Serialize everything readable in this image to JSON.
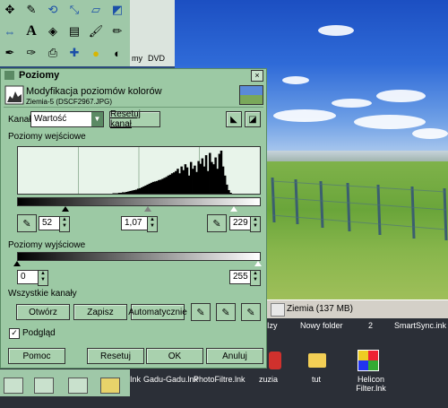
{
  "dialog": {
    "title": "Poziomy",
    "close": "×",
    "header_title": "Modyfikacja poziomów kolorów",
    "header_subtitle": "Ziemia-5 (DSCF2967.JPG)"
  },
  "channel": {
    "label": "Kanał:",
    "value": "Wartość",
    "reset_label": "Resetuj kanał"
  },
  "input_levels": {
    "label": "Poziomy wejściowe",
    "low": "52",
    "gamma": "1,07",
    "high": "229"
  },
  "output_levels": {
    "label": "Poziomy wyjściowe",
    "low": "0",
    "high": "255"
  },
  "all_channels": {
    "label": "Wszystkie kanały",
    "open": "Otwórz",
    "save": "Zapisz",
    "auto": "Automatycznie"
  },
  "preview": {
    "label": "Podgląd",
    "checked": true,
    "mark": "✓"
  },
  "buttons": {
    "help": "Pomoc",
    "reset": "Resetuj",
    "ok": "OK",
    "cancel": "Anuluj"
  },
  "image_window": {
    "status": "Ziemia (137 MB)"
  },
  "desktop": {
    "labels_top": [
      "Izy",
      "Nowy folder",
      "2",
      "SmartSync.ink"
    ],
    "labels_bottom": [
      "Ink",
      "Gadu-Gadu.lnk",
      "PhotoFiltre.lnk",
      "zuzia",
      "tut",
      "Helicon Filter.lnk"
    ],
    "thumb_labels": [
      "my",
      "DVD"
    ]
  },
  "histogram": [
    0,
    0,
    0,
    0,
    0,
    0,
    0,
    0,
    0,
    0,
    0,
    0,
    0,
    0,
    0,
    0,
    0,
    0,
    0,
    0,
    0,
    0,
    0,
    0,
    0,
    0,
    0,
    0,
    0,
    0,
    0,
    0,
    0,
    0,
    0,
    0,
    0,
    0,
    0,
    0,
    0,
    0,
    0,
    0,
    0,
    0,
    0,
    0,
    0,
    0,
    1,
    1,
    1,
    2,
    2,
    3,
    3,
    4,
    5,
    6,
    7,
    8,
    9,
    11,
    12,
    14,
    16,
    18,
    20,
    22,
    24,
    26,
    27,
    28,
    30,
    31,
    33,
    35,
    37,
    40,
    42,
    45,
    47,
    50,
    55,
    45,
    60,
    52,
    65,
    58,
    40,
    70,
    55,
    62,
    48,
    72,
    66,
    78,
    60,
    85,
    50,
    90,
    70,
    65,
    80,
    55,
    88,
    95,
    60,
    40,
    20,
    8,
    2,
    0,
    0,
    0,
    0,
    0,
    0,
    0,
    0,
    0,
    0,
    0,
    0,
    0,
    0,
    0
  ],
  "colors": {
    "dialog_bg": "#9cc9a4",
    "accent": "#5b8a64"
  }
}
